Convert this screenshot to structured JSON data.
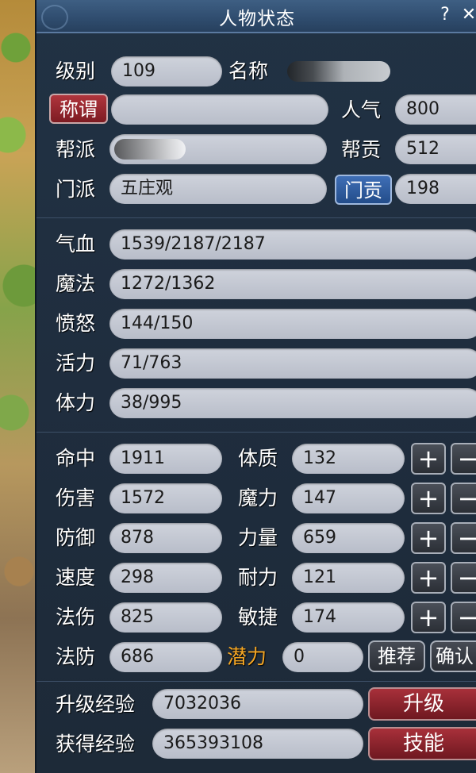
{
  "window": {
    "title": "人物状态",
    "help": "?",
    "close": "✕"
  },
  "profile": {
    "level_label": "级别",
    "level_value": "109",
    "name_label": "名称",
    "name_value": "",
    "title_button": "称谓",
    "title_value": "",
    "popularity_label": "人气",
    "popularity_value": "800",
    "guild_label": "帮派",
    "guild_value": "",
    "guild_contrib_label": "帮贡",
    "guild_contrib_value": "512",
    "sect_label": "门派",
    "sect_value": "五庄观",
    "sect_contrib_button": "门贡",
    "sect_contrib_value": "198"
  },
  "vitals": [
    {
      "label": "气血",
      "value": "1539/2187/2187"
    },
    {
      "label": "魔法",
      "value": "1272/1362"
    },
    {
      "label": "愤怒",
      "value": "144/150"
    },
    {
      "label": "活力",
      "value": "71/763"
    },
    {
      "label": "体力",
      "value": "38/995"
    }
  ],
  "combat": [
    {
      "label": "命中",
      "value": "1911"
    },
    {
      "label": "伤害",
      "value": "1572"
    },
    {
      "label": "防御",
      "value": "878"
    },
    {
      "label": "速度",
      "value": "298"
    },
    {
      "label": "法伤",
      "value": "825"
    },
    {
      "label": "法防",
      "value": "686"
    }
  ],
  "attributes": [
    {
      "label": "体质",
      "value": "132"
    },
    {
      "label": "魔力",
      "value": "147"
    },
    {
      "label": "力量",
      "value": "659"
    },
    {
      "label": "耐力",
      "value": "121"
    },
    {
      "label": "敏捷",
      "value": "174"
    }
  ],
  "buttons": {
    "plus": "+",
    "minus": "−"
  },
  "potential": {
    "label": "潜力",
    "value": "0",
    "recommend": "推荐",
    "confirm": "确认"
  },
  "experience": {
    "upgrade_label": "升级经验",
    "upgrade_value": "7032036",
    "upgrade_button": "升级",
    "gained_label": "获得经验",
    "gained_value": "365393108",
    "skills_button": "技能"
  },
  "colors": {
    "panel": "#1f2d3e",
    "field": "#c4c8d2",
    "accent_red": "#8e2530",
    "accent_blue": "#2f5c9e",
    "potential_label": "#f5a623"
  }
}
